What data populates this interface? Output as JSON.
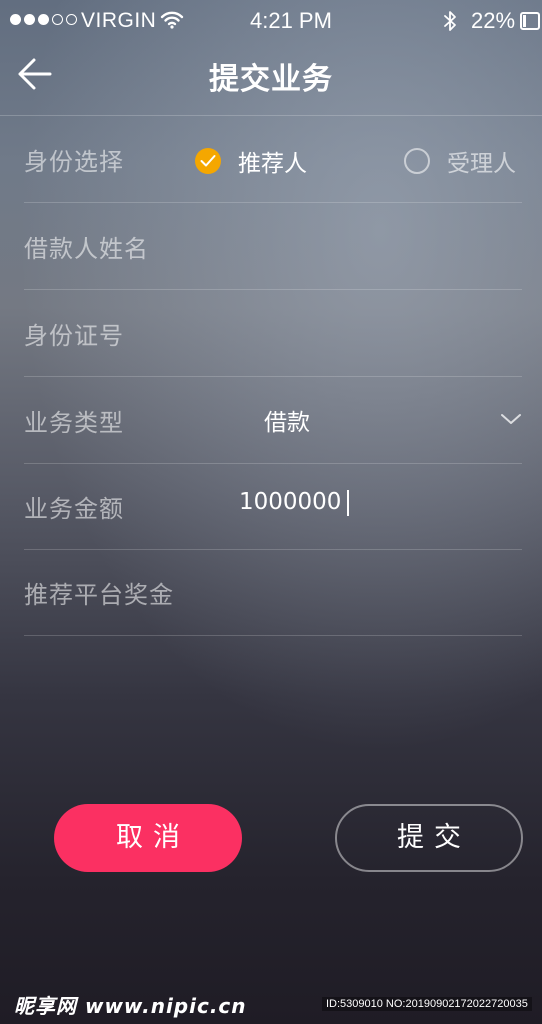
{
  "status_bar": {
    "signal": {
      "filled": 3,
      "total": 5
    },
    "carrier": "VIRGIN",
    "time": "4:21 PM",
    "battery_text": "22%",
    "battery_level": 0.22
  },
  "nav": {
    "title": "提交业务",
    "back_icon": "arrow-left-icon"
  },
  "form": {
    "identity": {
      "label": "身份选择",
      "options": [
        {
          "label": "推荐人",
          "selected": true
        },
        {
          "label": "受理人",
          "selected": false
        }
      ]
    },
    "borrower_name": {
      "label": "借款人姓名",
      "value": ""
    },
    "id_number": {
      "label": "身份证号",
      "value": ""
    },
    "business_type": {
      "label": "业务类型",
      "value": "借款",
      "icon": "chevron-down-icon"
    },
    "amount": {
      "label": "业务金额",
      "value": "1000000"
    },
    "platform_bonus": {
      "label": "推荐平台奖金",
      "value": ""
    }
  },
  "actions": {
    "cancel_label": "取消",
    "submit_label": "提交"
  },
  "colors": {
    "accent_checked": "#f5a700",
    "cancel_button": "#fb3062"
  },
  "watermark": {
    "logo": "昵享网 www.nipic.cn",
    "id_text": "ID:5309010 NO:20190902172022720035"
  }
}
